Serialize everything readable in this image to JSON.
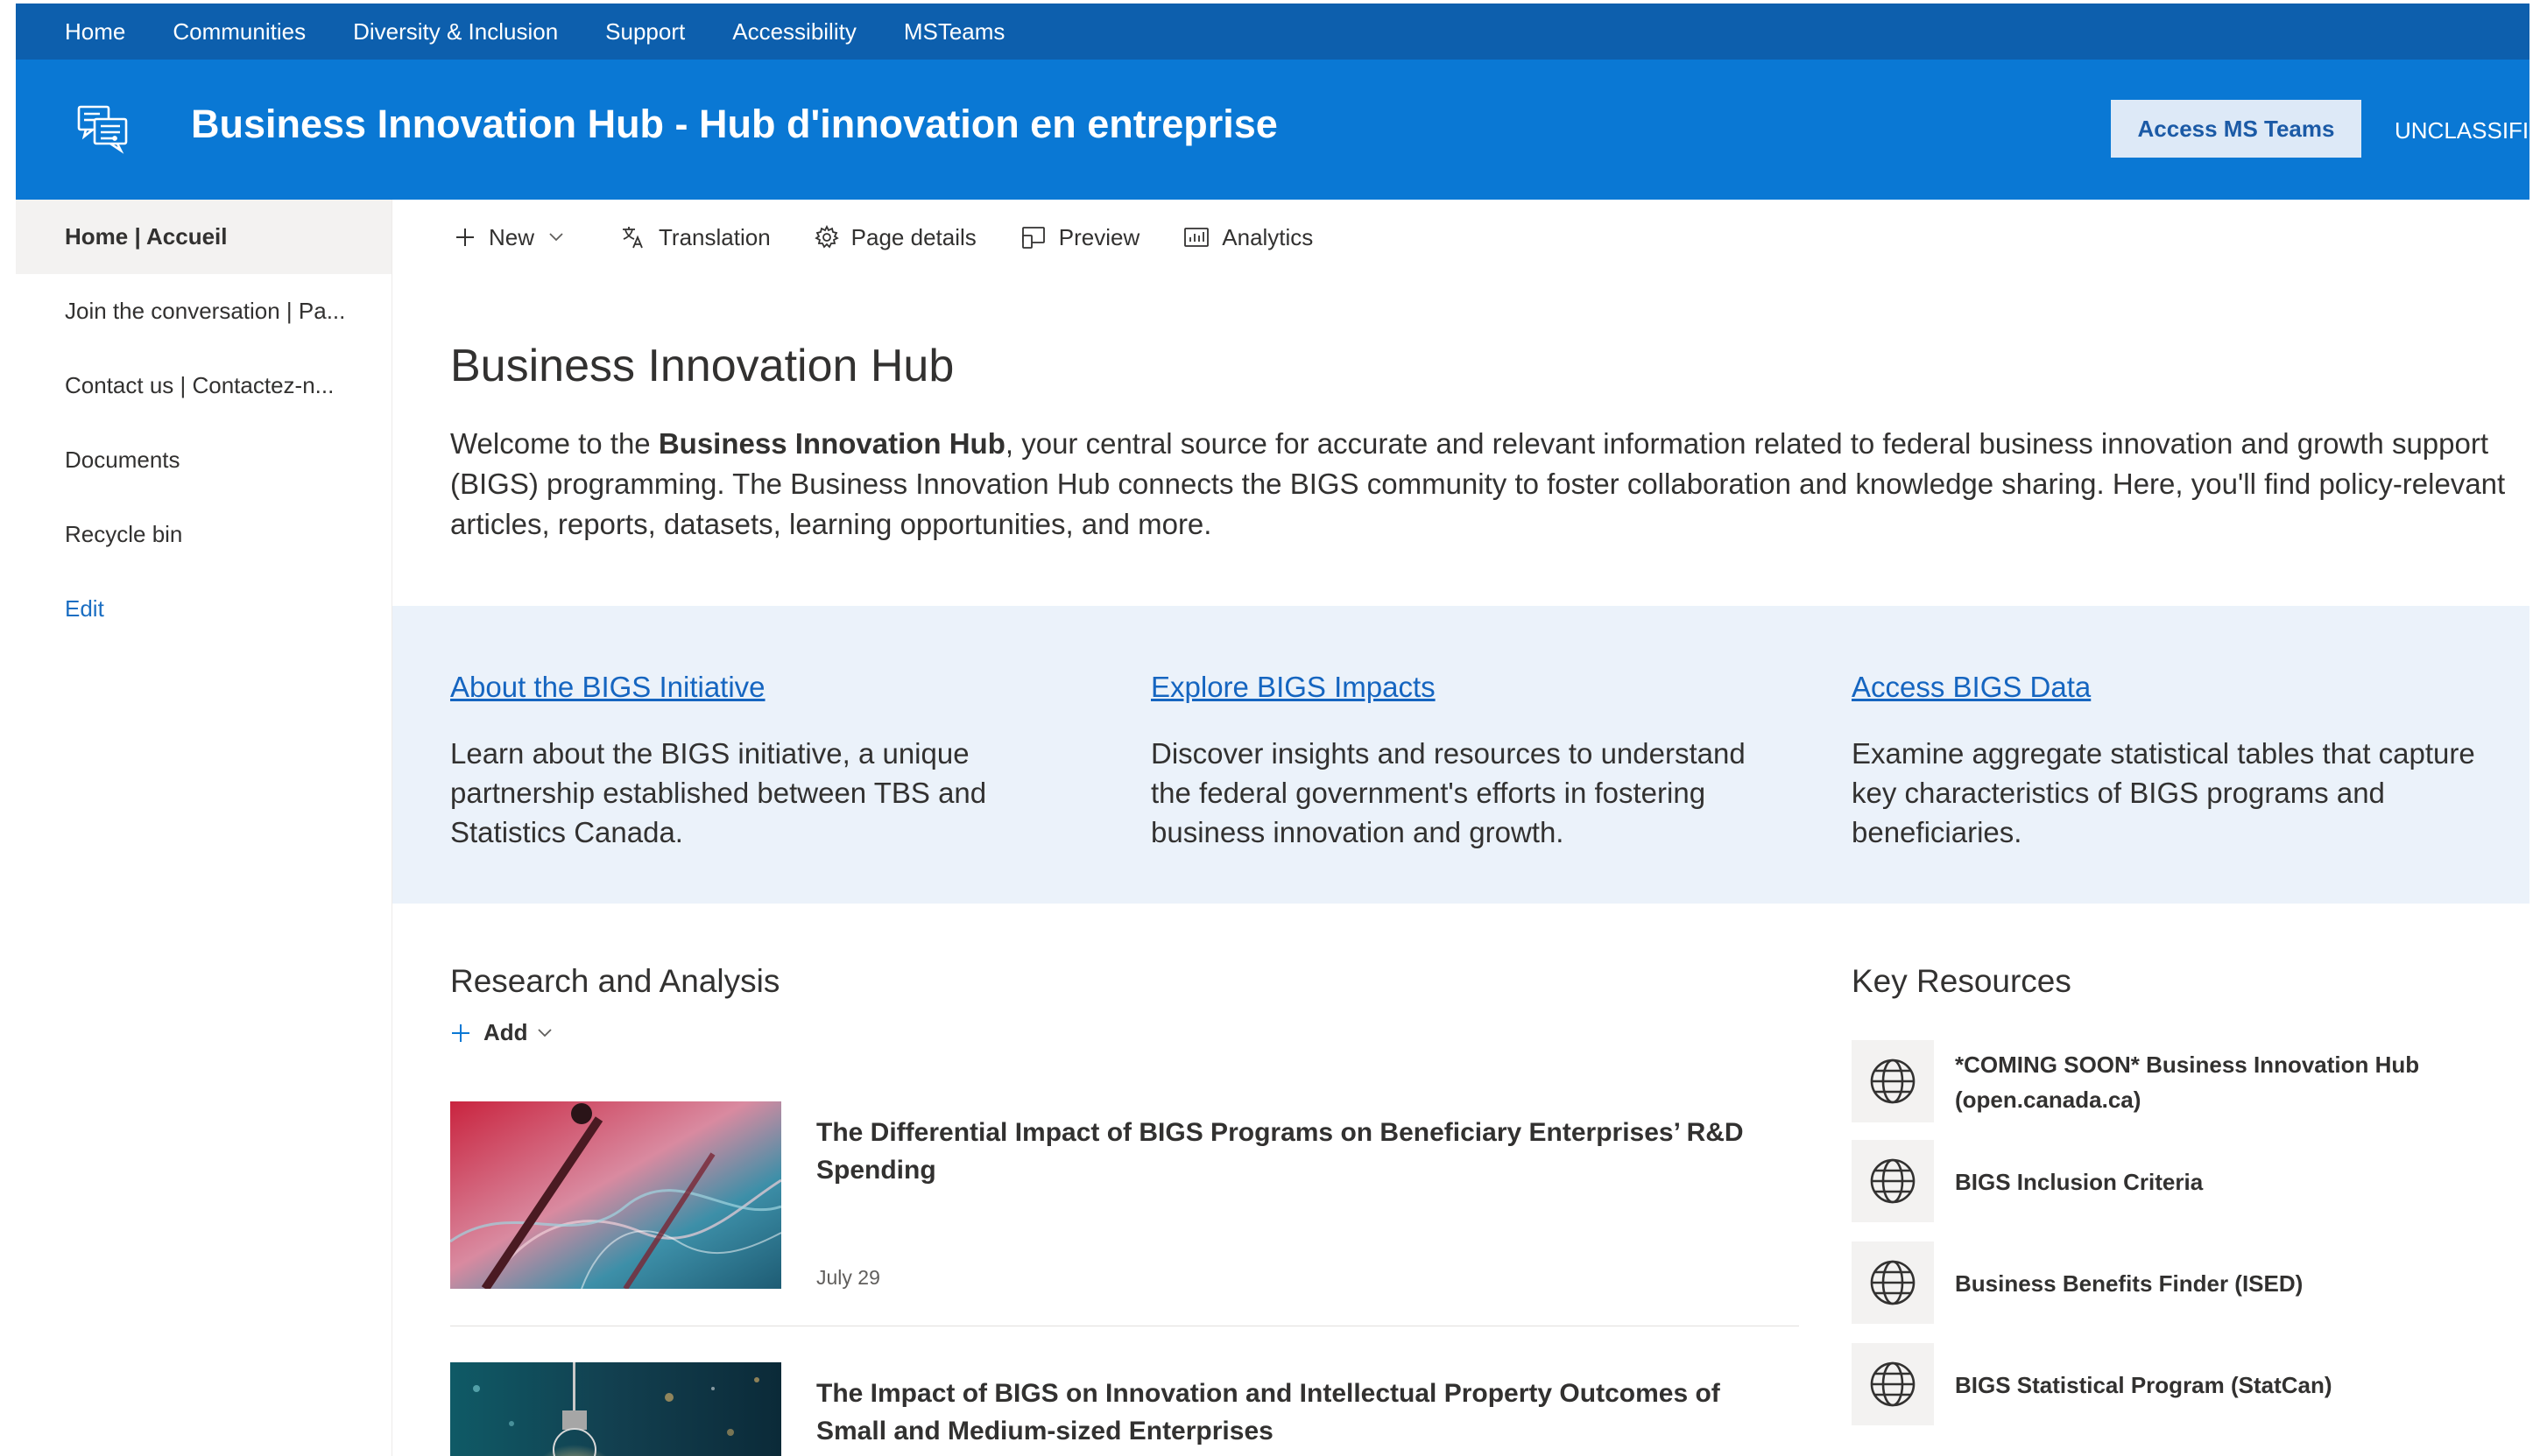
{
  "topnav": {
    "items": [
      "Home",
      "Communities",
      "Diversity & Inclusion",
      "Support",
      "Accessibility",
      "MSTeams"
    ]
  },
  "header": {
    "site_title": "Business Innovation Hub - Hub d'innovation en entreprise",
    "teams_button": "Access MS Teams",
    "classification": "UNCLASSIFIE",
    "logo_icon": "chat-hub-icon",
    "colors": {
      "topnav": "#0d5fad",
      "header": "#0a78d4"
    }
  },
  "leftnav": {
    "items": [
      "Home | Accueil",
      "Join the conversation | Pa...",
      "Contact us | Contactez-n...",
      "Documents",
      "Recycle bin"
    ],
    "edit": "Edit"
  },
  "commandbar": {
    "new": "New",
    "translation": "Translation",
    "page_details": "Page details",
    "preview": "Preview",
    "analytics": "Analytics"
  },
  "main": {
    "title": "Business Innovation Hub",
    "intro_prefix": "Welcome to the ",
    "intro_bold": "Business Innovation Hub",
    "intro_rest": ", your central source for accurate and relevant information related to federal business innovation and growth support (BIGS) programming. The Business Innovation Hub connects the BIGS community to foster collaboration and knowledge sharing. Here, you'll find policy-relevant articles, reports, datasets, learning opportunities, and more.",
    "highlights": [
      {
        "title": "About the BIGS Initiative",
        "text": "Learn about the BIGS initiative, a unique partnership established between TBS and Statistics Canada."
      },
      {
        "title": "Explore BIGS Impacts",
        "text": "Discover insights and resources to understand the federal government's efforts in fostering business innovation and growth."
      },
      {
        "title": "Access BIGS Data",
        "text": "Examine aggregate statistical tables that capture key characteristics of BIGS programs and beneficiaries."
      }
    ]
  },
  "research": {
    "title": "Research and Analysis",
    "add": "Add",
    "articles": [
      {
        "title": "The Differential Impact of BIGS Programs on Beneficiary Enterprises’ R&D Spending",
        "date": "July 29"
      },
      {
        "title": "The Impact of BIGS on Innovation and Intellectual Property Outcomes of Small and Medium-sized Enterprises",
        "date": ""
      }
    ]
  },
  "key_resources": {
    "title": "Key Resources",
    "icon": "globe-icon",
    "items": [
      "*COMING SOON* Business Innovation Hub (open.canada.ca)",
      "BIGS Inclusion Criteria",
      "Business Benefits Finder (ISED)",
      "BIGS Statistical Program (StatCan)"
    ]
  }
}
